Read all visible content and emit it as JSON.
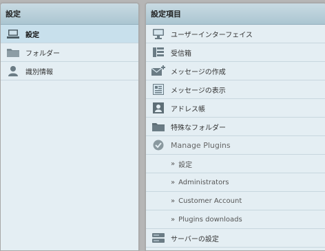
{
  "left_panel": {
    "title": "設定",
    "items": [
      {
        "label": "設定",
        "icon": "computer-icon",
        "selected": true
      },
      {
        "label": "フォルダー",
        "icon": "folder-icon",
        "selected": false
      },
      {
        "label": "識別情報",
        "icon": "user-icon",
        "selected": false
      }
    ]
  },
  "right_panel": {
    "title": "設定項目",
    "items": [
      {
        "label": "ユーザーインターフェイス",
        "icon": "monitor-icon"
      },
      {
        "label": "受信箱",
        "icon": "inbox-icon"
      },
      {
        "label": "メッセージの作成",
        "icon": "compose-icon"
      },
      {
        "label": "メッセージの表示",
        "icon": "message-view-icon"
      },
      {
        "label": "アドレス帳",
        "icon": "addressbook-icon"
      },
      {
        "label": "特殊なフォルダー",
        "icon": "folder-icon"
      },
      {
        "label": "Manage Plugins",
        "icon": "checkmark-icon"
      }
    ],
    "plugin_subitems": [
      {
        "label": "設定",
        "arrow": "»"
      },
      {
        "label": "Administrators",
        "arrow": "»"
      },
      {
        "label": "Customer Account",
        "arrow": "»"
      },
      {
        "label": "Plugins downloads",
        "arrow": "»"
      }
    ],
    "server_item": {
      "label": "サーバーの設定",
      "icon": "server-icon"
    }
  },
  "colors": {
    "background": "#b6b6b6",
    "panel": "#e4eef3",
    "header": "#abc5d1",
    "selected": "#c8e0ec",
    "icon": "#6b7c85"
  }
}
